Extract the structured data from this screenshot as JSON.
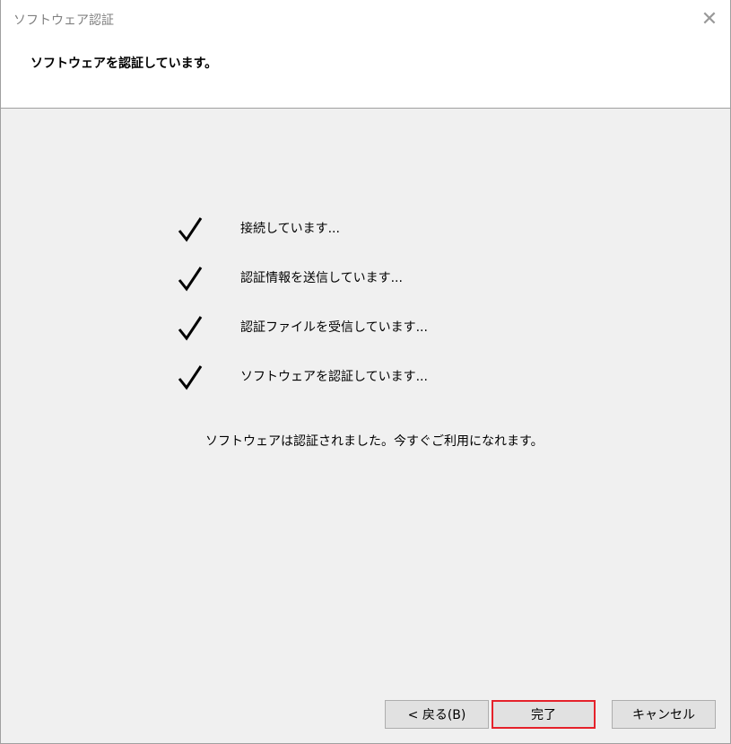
{
  "window": {
    "title": "ソフトウェア認証",
    "close_glyph": "✕"
  },
  "header": {
    "text": "ソフトウェアを認証しています。"
  },
  "steps": [
    {
      "label": "接続しています..."
    },
    {
      "label": "認証情報を送信しています..."
    },
    {
      "label": "認証ファイルを受信しています..."
    },
    {
      "label": "ソフトウェアを認証しています..."
    }
  ],
  "message": "ソフトウェアは認証されました。今すぐご利用になれます。",
  "buttons": {
    "back": "< 戻る(B)",
    "finish": "完了",
    "cancel": "キャンセル"
  },
  "colors": {
    "accent_border": "#e5222b"
  }
}
